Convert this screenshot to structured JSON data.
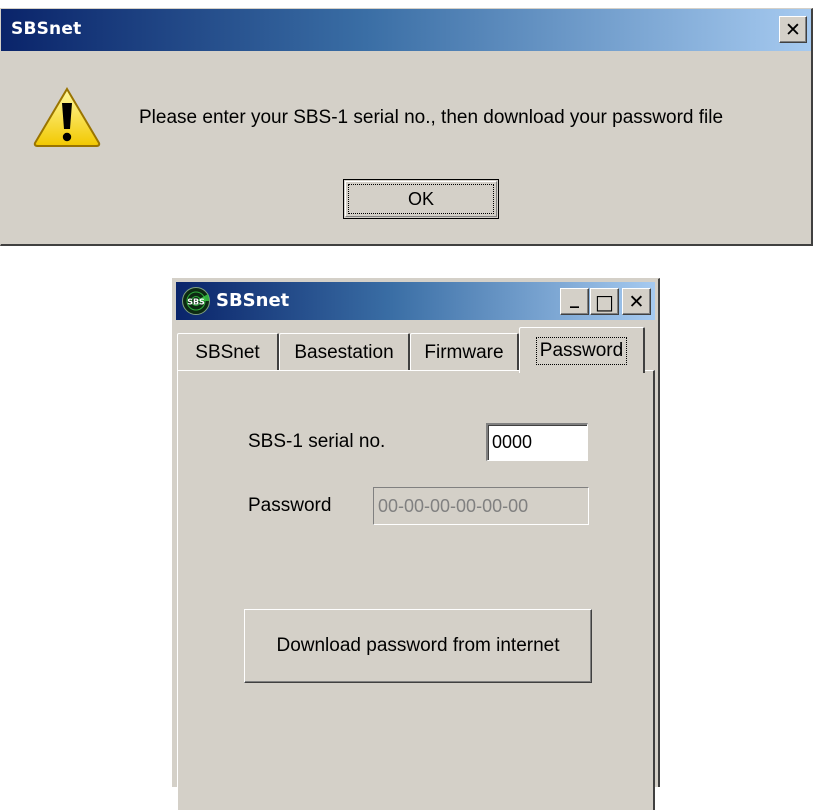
{
  "message_box": {
    "title": "SBSnet",
    "close_glyph": "✕",
    "icon": "warning-icon",
    "message": "Please enter your SBS-1 serial no., then download your password file",
    "ok_label": "OK"
  },
  "window": {
    "title": "SBSnet",
    "app_icon": "sbs-radar-icon",
    "min_glyph": "_",
    "max_glyph": "□",
    "close_glyph": "✕",
    "tabs": [
      {
        "label": "SBSnet",
        "active": false
      },
      {
        "label": "Basestation",
        "active": false
      },
      {
        "label": "Firmware",
        "active": false
      },
      {
        "label": "Password",
        "active": true
      }
    ],
    "password_tab": {
      "serial_label": "SBS-1 serial no.",
      "serial_value": "0000",
      "password_label": "Password",
      "password_value": "00-00-00-00-00-00",
      "download_button": "Download password from internet"
    }
  },
  "colors": {
    "title_gradient_start": "#0a246a",
    "title_gradient_end": "#a6caf0",
    "face": "#d4d0c8",
    "disabled_text": "#808080"
  }
}
